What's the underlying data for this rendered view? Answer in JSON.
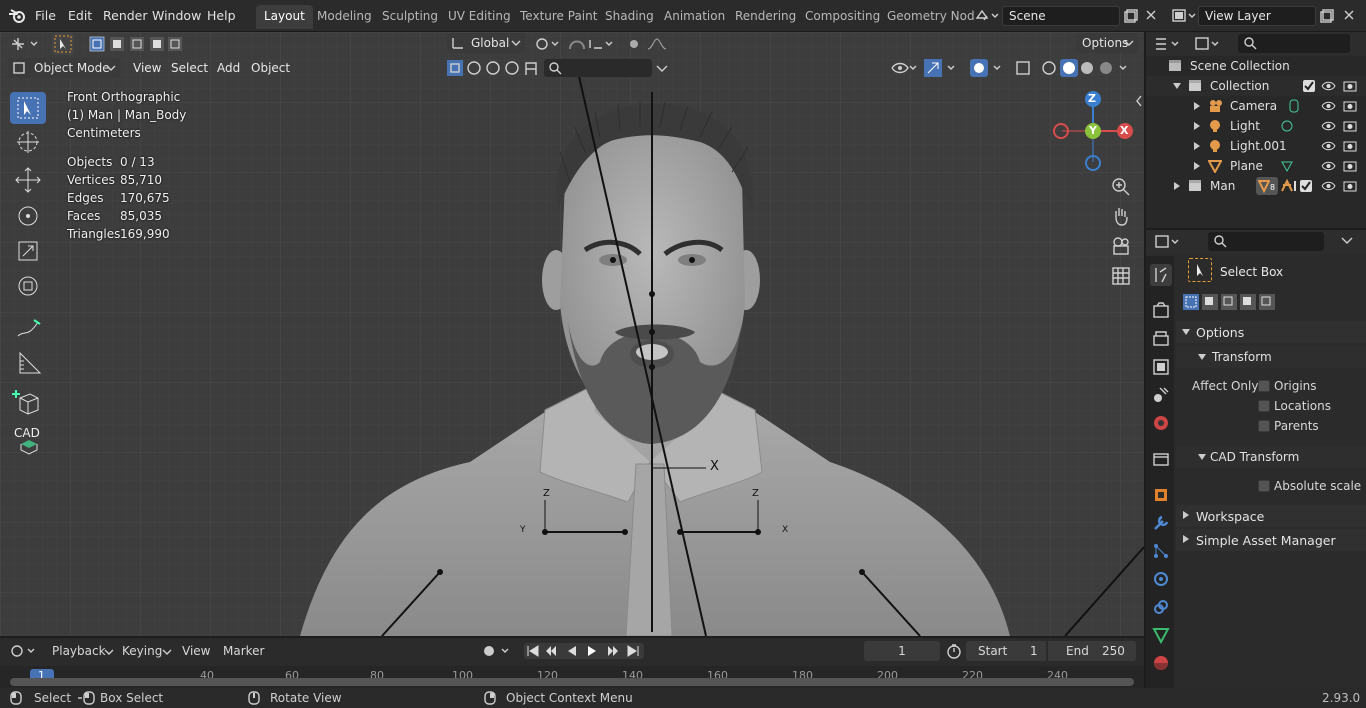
{
  "menus": [
    "File",
    "Edit",
    "Render",
    "Window",
    "Help"
  ],
  "workspaces": [
    "Layout",
    "Modeling",
    "Sculpting",
    "UV Editing",
    "Texture Paint",
    "Shading",
    "Animation",
    "Rendering",
    "Compositing",
    "Geometry Nod"
  ],
  "scene": "Scene",
  "view_layer": "View Layer",
  "viewport": {
    "orientation": "Global",
    "options": "Options",
    "mode": "Object Mode",
    "menu": [
      "View",
      "Select",
      "Add",
      "Object"
    ],
    "view_name": "Front Orthographic",
    "object_name": "(1) Man | Man_Body",
    "units": "Centimeters",
    "stats": [
      {
        "label": "Objects",
        "value": "0 / 13"
      },
      {
        "label": "Vertices",
        "value": "85,710"
      },
      {
        "label": "Edges",
        "value": "170,675"
      },
      {
        "label": "Faces",
        "value": "85,035"
      },
      {
        "label": "Triangles",
        "value": "169,990"
      }
    ],
    "gizmo": {
      "x": "X",
      "y": "Y",
      "z": "Z"
    },
    "cad_label": "CAD",
    "bone_labels": {
      "z": "Z",
      "x": "X",
      "y": "Y"
    }
  },
  "outliner": {
    "root": "Scene Collection",
    "items": [
      {
        "label": "Collection"
      },
      {
        "label": "Camera"
      },
      {
        "label": "Light"
      },
      {
        "label": "Light.001"
      },
      {
        "label": "Plane"
      },
      {
        "label": "Man"
      }
    ],
    "man_badge": "8"
  },
  "properties": {
    "tool_name": "Select Box",
    "options": "Options",
    "transform": "Transform",
    "affect_only": "Affect Only",
    "checks": [
      "Origins",
      "Locations",
      "Parents"
    ],
    "cad_transform": "CAD Transform",
    "absolute_scale": "Absolute scale",
    "workspace": "Workspace",
    "asset_manager": "Simple Asset Manager"
  },
  "timeline": {
    "menus": [
      "Playback",
      "Keying",
      "View",
      "Marker"
    ],
    "current_frame": "1",
    "start_label": "Start",
    "start": "1",
    "end_label": "End",
    "end": "250",
    "ticks": [
      "1",
      "40",
      "60",
      "80",
      "100",
      "120",
      "140",
      "160",
      "180",
      "200",
      "220",
      "240"
    ]
  },
  "status": {
    "select": "Select",
    "box_select": "Box Select",
    "rotate_view": "Rotate View",
    "context_menu": "Object Context Menu",
    "version": "2.93.0"
  }
}
